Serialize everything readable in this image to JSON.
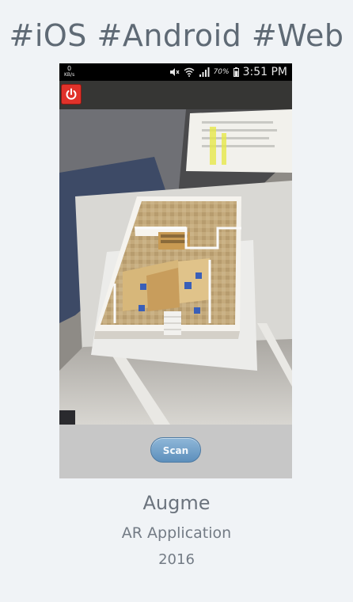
{
  "headline": "#iOS #Android #Web",
  "phone": {
    "status_bar": {
      "net_rate": "0",
      "net_unit": "KB/s",
      "battery": "70%",
      "time": "3:51 PM"
    },
    "icons": {
      "power": "power-icon",
      "wifi": "wifi-icon",
      "signal": "signal-icon",
      "battery": "battery-icon",
      "mute": "mute-icon"
    },
    "scan_label": "Scan"
  },
  "project": {
    "title": "Augme",
    "subtitle": "AR Application",
    "year": "2016"
  },
  "colors": {
    "background": "#f0f3f6",
    "headline_text": "#5f6a75",
    "power_button": "#e0322a",
    "scan_button": "#6f9ec6"
  }
}
